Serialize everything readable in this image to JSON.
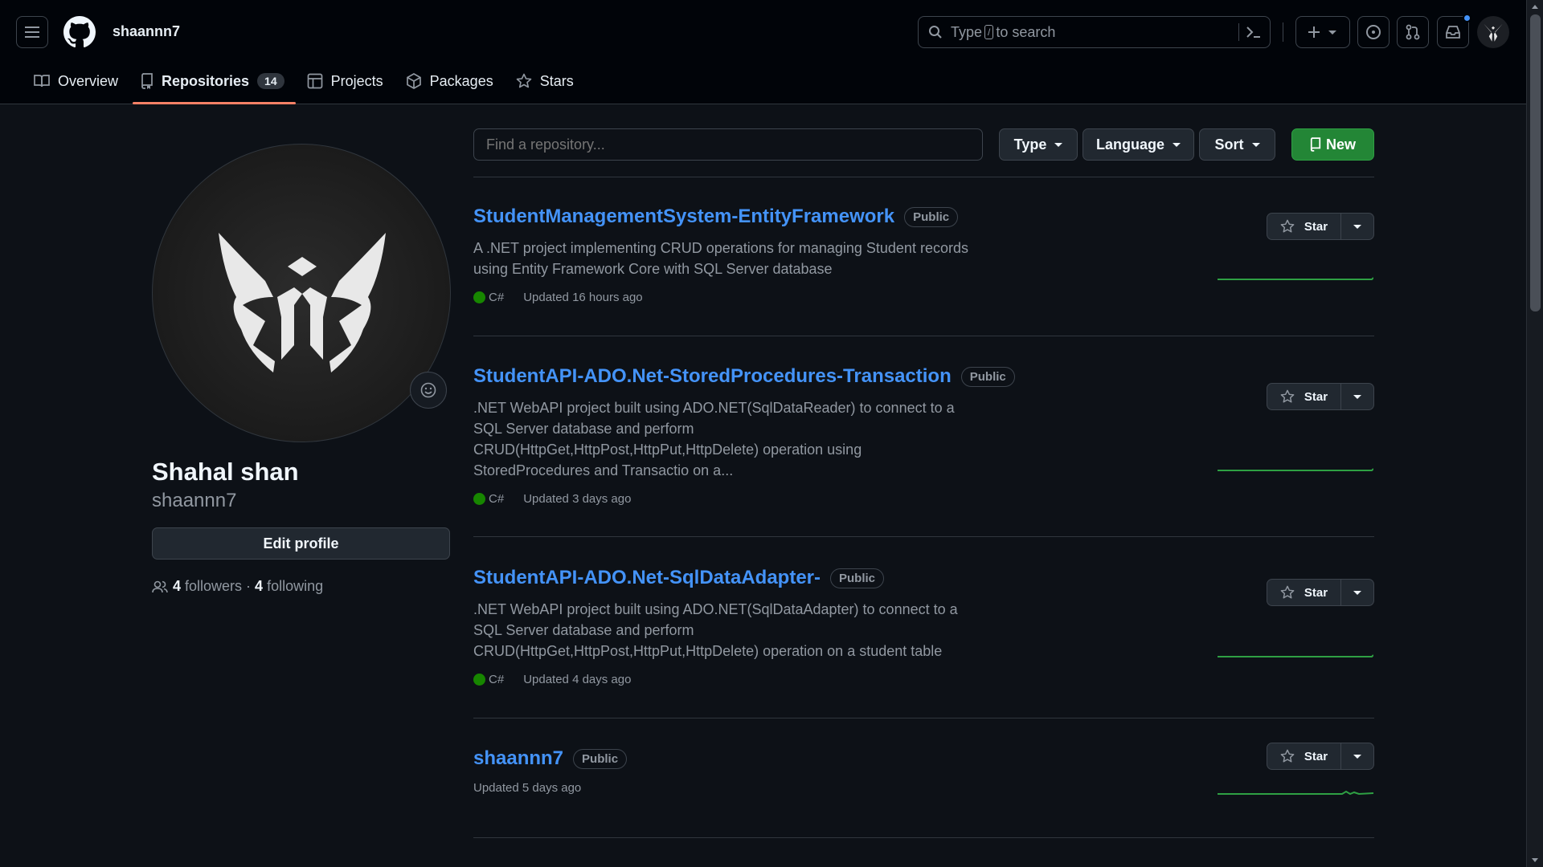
{
  "header": {
    "username": "shaannn7",
    "search_prefix": "Type",
    "search_key": "/",
    "search_suffix": "to search"
  },
  "tabs": [
    {
      "label": "Overview",
      "icon": "book-icon"
    },
    {
      "label": "Repositories",
      "icon": "repo-icon",
      "count": "14",
      "active": true
    },
    {
      "label": "Projects",
      "icon": "table-icon"
    },
    {
      "label": "Packages",
      "icon": "package-icon"
    },
    {
      "label": "Stars",
      "icon": "star-icon"
    }
  ],
  "profile": {
    "full_name": "Shahal shan",
    "login": "shaannn7",
    "edit_label": "Edit profile",
    "followers_count": "4",
    "followers_label": "followers",
    "separator": "·",
    "following_count": "4",
    "following_label": "following"
  },
  "filters": {
    "search_placeholder": "Find a repository...",
    "type_label": "Type",
    "language_label": "Language",
    "sort_label": "Sort",
    "new_label": "New"
  },
  "repos": [
    {
      "name": "StudentManagementSystem-EntityFramework",
      "visibility": "Public",
      "description": "A .NET project implementing CRUD operations for managing Student records using Entity Framework Core with SQL Server database",
      "language": "C#",
      "updated": "Updated 16 hours ago",
      "star_label": "Star"
    },
    {
      "name": "StudentAPI-ADO.Net-StoredProcedures-Transaction",
      "visibility": "Public",
      "description": ".NET WebAPI project built using ADO.NET(SqlDataReader) to connect to a SQL Server database and perform CRUD(HttpGet,HttpPost,HttpPut,HttpDelete) operation using StoredProcedures and Transactio on a...",
      "language": "C#",
      "updated": "Updated 3 days ago",
      "star_label": "Star"
    },
    {
      "name": "StudentAPI-ADO.Net-SqlDataAdapter-",
      "visibility": "Public",
      "description": ".NET WebAPI project built using ADO.NET(SqlDataAdapter) to connect to a SQL Server database and perform CRUD(HttpGet,HttpPost,HttpPut,HttpDelete) operation on a student table",
      "language": "C#",
      "updated": "Updated 4 days ago",
      "star_label": "Star"
    },
    {
      "name": "shaannn7",
      "visibility": "Public",
      "description": "",
      "language": "",
      "updated": "Updated 5 days ago",
      "star_label": "Star"
    }
  ],
  "colors": {
    "accent_link": "#4493f8",
    "tab_underline": "#f78166",
    "new_button": "#238636",
    "csharp": "#178600"
  }
}
